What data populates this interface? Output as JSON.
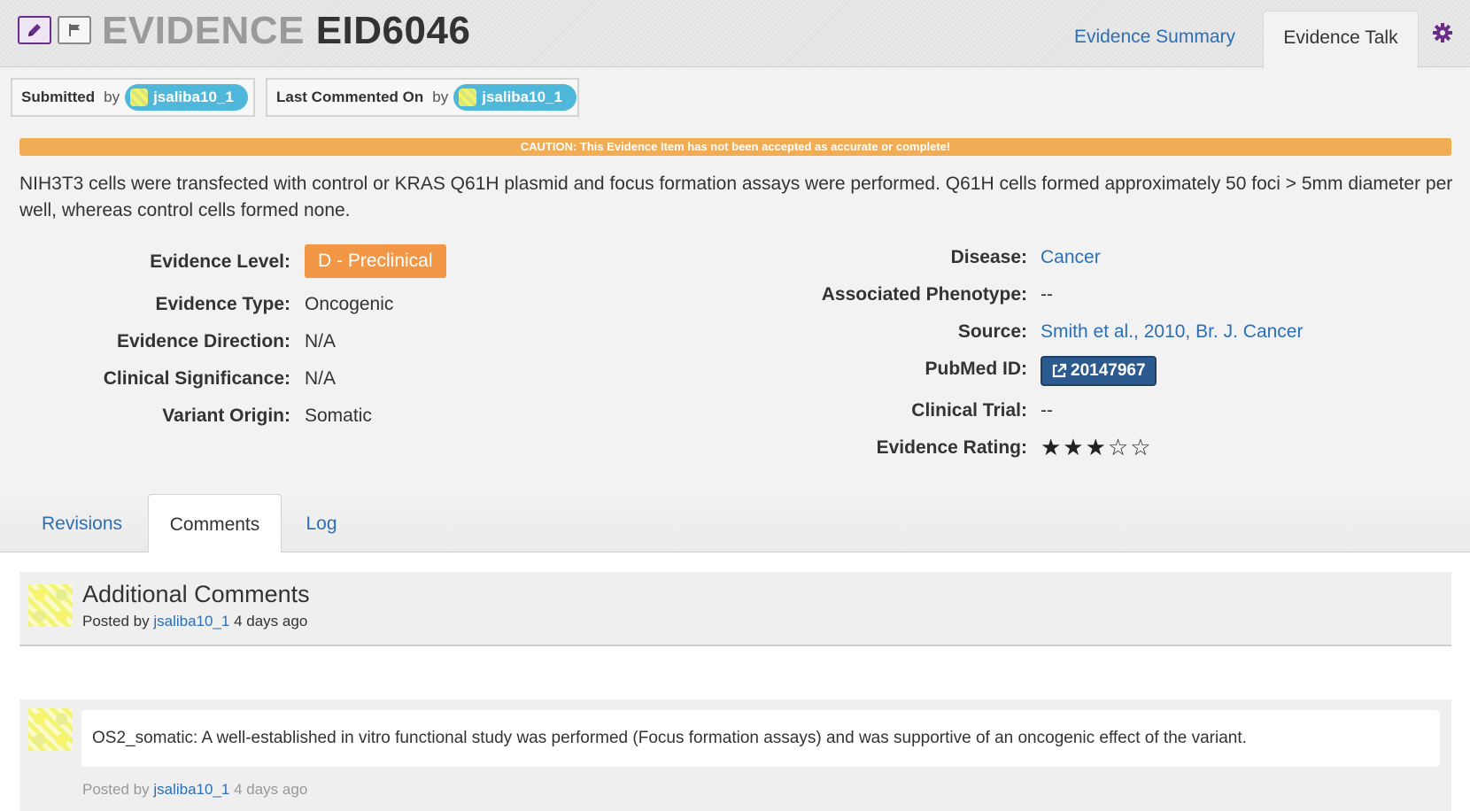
{
  "header": {
    "title_prefix": "EVIDENCE",
    "title_id": "EID6046",
    "tabs": [
      "Evidence Summary",
      "Evidence Talk"
    ]
  },
  "meta": {
    "submitted_label": "Submitted",
    "submitted_by": "by",
    "submitted_user": "jsaliba10_1",
    "commented_label": "Last Commented On",
    "commented_by": "by",
    "commented_user": "jsaliba10_1"
  },
  "caution": "CAUTION: This Evidence Item has not been accepted as accurate or complete!",
  "description": "NIH3T3 cells were transfected with control or KRAS Q61H plasmid and focus formation assays were performed. Q61H cells formed approximately 50 foci > 5mm diameter per well, whereas control cells formed none.",
  "left_fields": {
    "level_label": "Evidence Level:",
    "level_value": "D - Preclinical",
    "type_label": "Evidence Type:",
    "type_value": "Oncogenic",
    "direction_label": "Evidence Direction:",
    "direction_value": "N/A",
    "significance_label": "Clinical Significance:",
    "significance_value": "N/A",
    "origin_label": "Variant Origin:",
    "origin_value": "Somatic"
  },
  "right_fields": {
    "disease_label": "Disease:",
    "disease_value": "Cancer",
    "phenotype_label": "Associated Phenotype:",
    "phenotype_value": "--",
    "source_label": "Source:",
    "source_value": "Smith et al., 2010, Br. J. Cancer",
    "pubmed_label": "PubMed ID:",
    "pubmed_value": "20147967",
    "trial_label": "Clinical Trial:",
    "trial_value": "--",
    "rating_label": "Evidence Rating:",
    "rating_stars": "★★★☆☆",
    "rating_value": 3,
    "rating_max": 5
  },
  "bottom_tabs": [
    "Revisions",
    "Comments",
    "Log"
  ],
  "comments": {
    "head_title": "Additional Comments",
    "posted_by": "Posted by",
    "head_user": "jsaliba10_1",
    "head_time": "4 days ago",
    "items": [
      {
        "text": "OS2_somatic: A well-established in vitro functional study was performed (Focus formation assays) and was supportive of an oncogenic effect of the variant.",
        "posted_by": "Posted by",
        "user": "jsaliba10_1",
        "time": "4 days ago"
      }
    ]
  },
  "colors": {
    "accent_link": "#2c6fb5",
    "level_badge": "#f29745",
    "caution": "#f0ad55",
    "user_pill": "#4fb7d9",
    "pubmed_btn": "#2d5a8e"
  }
}
